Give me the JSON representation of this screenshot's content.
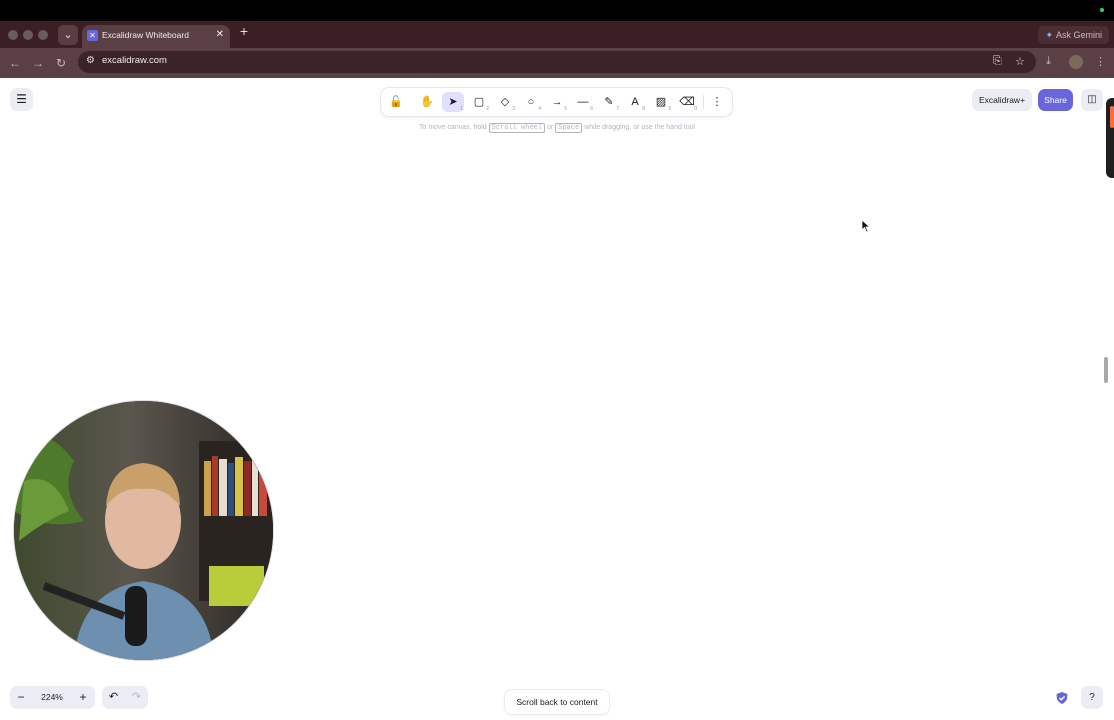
{
  "browser": {
    "tab_title": "Excalidraw Whiteboard",
    "tab_close_glyph": "✕",
    "new_tab_glyph": "+",
    "tab_list_glyph": "⌄",
    "gemini_label": "Ask Gemini",
    "url": "excalidraw.com",
    "back_glyph": "←",
    "forward_glyph": "→",
    "reload_glyph": "↻",
    "site_info_glyph": "⚙",
    "install_glyph": "⎘",
    "bookmark_glyph": "☆",
    "download_glyph": "⤓",
    "menu_glyph": "⋮"
  },
  "app": {
    "menu_glyph": "☰",
    "toolbar": [
      {
        "name": "lock-tool",
        "glyph": "🔓",
        "key": ""
      },
      {
        "name": "hand-tool",
        "glyph": "✋",
        "key": ""
      },
      {
        "name": "selection-tool",
        "glyph": "➤",
        "key": "1",
        "active": true
      },
      {
        "name": "rectangle-tool",
        "glyph": "▢",
        "key": "2"
      },
      {
        "name": "diamond-tool",
        "glyph": "◇",
        "key": "3"
      },
      {
        "name": "ellipse-tool",
        "glyph": "○",
        "key": "4"
      },
      {
        "name": "arrow-tool",
        "glyph": "→",
        "key": "5"
      },
      {
        "name": "line-tool",
        "glyph": "—",
        "key": "6"
      },
      {
        "name": "draw-tool",
        "glyph": "✎",
        "key": "7"
      },
      {
        "name": "text-tool",
        "glyph": "A",
        "key": "8"
      },
      {
        "name": "image-tool",
        "glyph": "▨",
        "key": "9"
      },
      {
        "name": "eraser-tool",
        "glyph": "⌫",
        "key": "0"
      }
    ],
    "more_tools_glyph": "⋮",
    "hint": {
      "prefix": "To move canvas, hold",
      "key1": "Scroll wheel",
      "middle": "or",
      "key2": "Space",
      "suffix": "while dragging, or use the hand tool"
    },
    "excalidraw_plus_label": "Excalidraw+",
    "share_label": "Share",
    "library_glyph": "◫",
    "zoom_out_glyph": "−",
    "zoom_level": "224%",
    "zoom_in_glyph": "+",
    "undo_glyph": "↶",
    "redo_glyph": "↷",
    "scroll_back_label": "Scroll back to content",
    "help_glyph": "?"
  },
  "colors": {
    "accent": "#6965db",
    "active_tool_bg": "#e0dfff",
    "browser_tab_strip": "#3b1f24",
    "browser_toolbar": "#5a3f45"
  }
}
